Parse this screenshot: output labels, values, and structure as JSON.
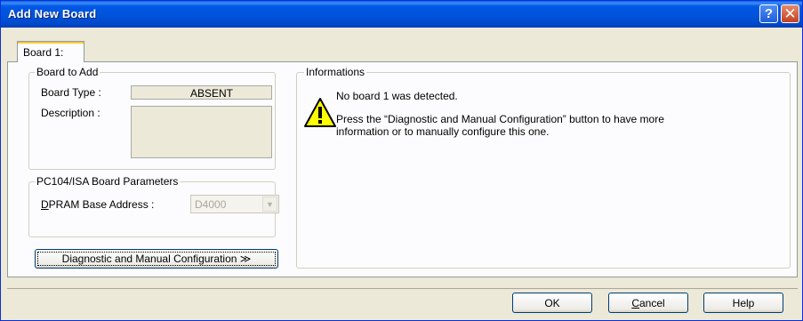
{
  "window": {
    "title": "Add New Board",
    "help_glyph": "?",
    "close_glyph": "✕"
  },
  "tabs": [
    {
      "label": "Board 1:"
    }
  ],
  "board_to_add": {
    "legend": "Board to Add",
    "type_label": "Board Type :",
    "type_value": "ABSENT",
    "description_label": "Description :",
    "description_value": ""
  },
  "pc104": {
    "legend": "PC104/ISA Board Parameters",
    "dpram_label_first": "D",
    "dpram_label_rest": "PRAM Base Address :",
    "dpram_value": "D4000"
  },
  "diagnostic_button": {
    "label": "Diagnostic and Manual Configuration  ≫"
  },
  "informations": {
    "legend": "Informations",
    "icon": "warning-icon",
    "line1": "No board 1 was detected.",
    "line2": "Press the “Diagnostic and Manual Configuration” button to have more",
    "line3": "information or to manually configure this one."
  },
  "footer": {
    "ok_label": "OK",
    "cancel_first": "C",
    "cancel_rest": "ancel",
    "help_label": "Help"
  },
  "colors": {
    "titlebar": "#0054e3",
    "dialog_bg": "#ece9d8",
    "warning_yellow": "#ffff00"
  }
}
